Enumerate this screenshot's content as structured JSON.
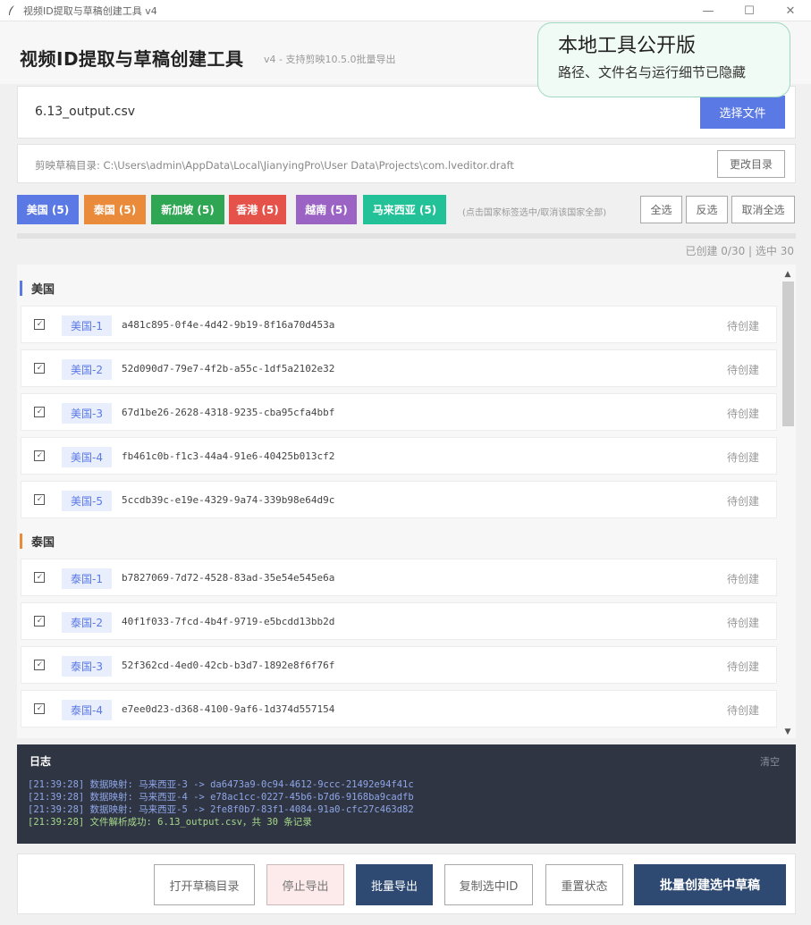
{
  "window": {
    "title": "视频ID提取与草稿创建工具 v4",
    "minimize": "—",
    "maximize": "☐",
    "close": "✕"
  },
  "header": {
    "title": "视频ID提取与草稿创建工具",
    "subtitle": "v4 - 支持剪映10.5.0批量导出"
  },
  "notice": {
    "title": "本地工具公开版",
    "text": "路径、文件名与运行细节已隐藏"
  },
  "file": {
    "name": "6.13_output.csv",
    "choose_label": "选择文件"
  },
  "draft_dir": {
    "text": "剪映草稿目录: C:\\Users\\admin\\AppData\\Local\\JianyingPro\\User Data\\Projects\\com.lveditor.draft",
    "change_label": "更改目录"
  },
  "tags": [
    {
      "label": "美国 (5)",
      "color": "#5b79e4"
    },
    {
      "label": "泰国 (5)",
      "color": "#e98b3a"
    },
    {
      "label": "新加坡 (5)",
      "color": "#2fa653"
    },
    {
      "label": "香港 (5)",
      "color": "#e4524a"
    },
    {
      "label": "越南 (5)",
      "color": "#9a63c4"
    },
    {
      "label": "马来西亚 (5)",
      "color": "#23c197"
    }
  ],
  "tag_hint": "(点击国家标签选中/取消该国家全部)",
  "selection": {
    "select_all": "全选",
    "invert": "反选",
    "deselect_all": "取消全选"
  },
  "stats": "已创建 0/30 | 选中 30",
  "groups": [
    {
      "name": "美国",
      "color": "#5b79e4",
      "items": [
        {
          "badge": "美国-1",
          "id": "a481c895-0f4e-4d42-9b19-8f16a70d453a",
          "status": "待创建",
          "checked": "🗸"
        },
        {
          "badge": "美国-2",
          "id": "52d090d7-79e7-4f2b-a55c-1df5a2102e32",
          "status": "待创建",
          "checked": "🗸"
        },
        {
          "badge": "美国-3",
          "id": "67d1be26-2628-4318-9235-cba95cfa4bbf",
          "status": "待创建",
          "checked": "🗸"
        },
        {
          "badge": "美国-4",
          "id": "fb461c0b-f1c3-44a4-91e6-40425b013cf2",
          "status": "待创建",
          "checked": "🗸"
        },
        {
          "badge": "美国-5",
          "id": "5ccdb39c-e19e-4329-9a74-339b98e64d9c",
          "status": "待创建",
          "checked": "🗸"
        }
      ]
    },
    {
      "name": "泰国",
      "color": "#e98b3a",
      "items": [
        {
          "badge": "泰国-1",
          "id": "b7827069-7d72-4528-83ad-35e54e545e6a",
          "status": "待创建",
          "checked": "🗸"
        },
        {
          "badge": "泰国-2",
          "id": "40f1f033-7fcd-4b4f-9719-e5bcdd13bb2d",
          "status": "待创建",
          "checked": "🗸"
        },
        {
          "badge": "泰国-3",
          "id": "52f362cd-4ed0-42cb-b3d7-1892e8f6f76f",
          "status": "待创建",
          "checked": "🗸"
        },
        {
          "badge": "泰国-4",
          "id": "e7ee0d23-d368-4100-9af6-1d374d557154",
          "status": "待创建",
          "checked": "🗸"
        }
      ]
    }
  ],
  "log": {
    "title": "日志",
    "clear_label": "清空",
    "lines": [
      {
        "text": "[21:39:28] 数据映射: 马来西亚-3 -> da6473a9-0c94-4612-9ccc-21492e94f41c",
        "color": "#8fa6e8"
      },
      {
        "text": "[21:39:28] 数据映射: 马来西亚-4 -> e78ac1cc-0227-45b6-b7d6-9168ba9cadfb",
        "color": "#8fa6e8"
      },
      {
        "text": "[21:39:28] 数据映射: 马来西亚-5 -> 2fe8f0b7-83f1-4084-91a0-cfc27c463d82",
        "color": "#8fa6e8"
      },
      {
        "text": "[21:39:28] 文件解析成功: 6.13_output.csv，共 30 条记录",
        "color": "#a6d98a"
      }
    ]
  },
  "footer": {
    "open_dir": "打开草稿目录",
    "stop_export": "停止导出",
    "batch_export": "批量导出",
    "copy_ids": "复制选中ID",
    "reset": "重置状态",
    "create_drafts": "批量创建选中草稿"
  },
  "scrollbar": {
    "up": "▲",
    "down": "▼"
  }
}
